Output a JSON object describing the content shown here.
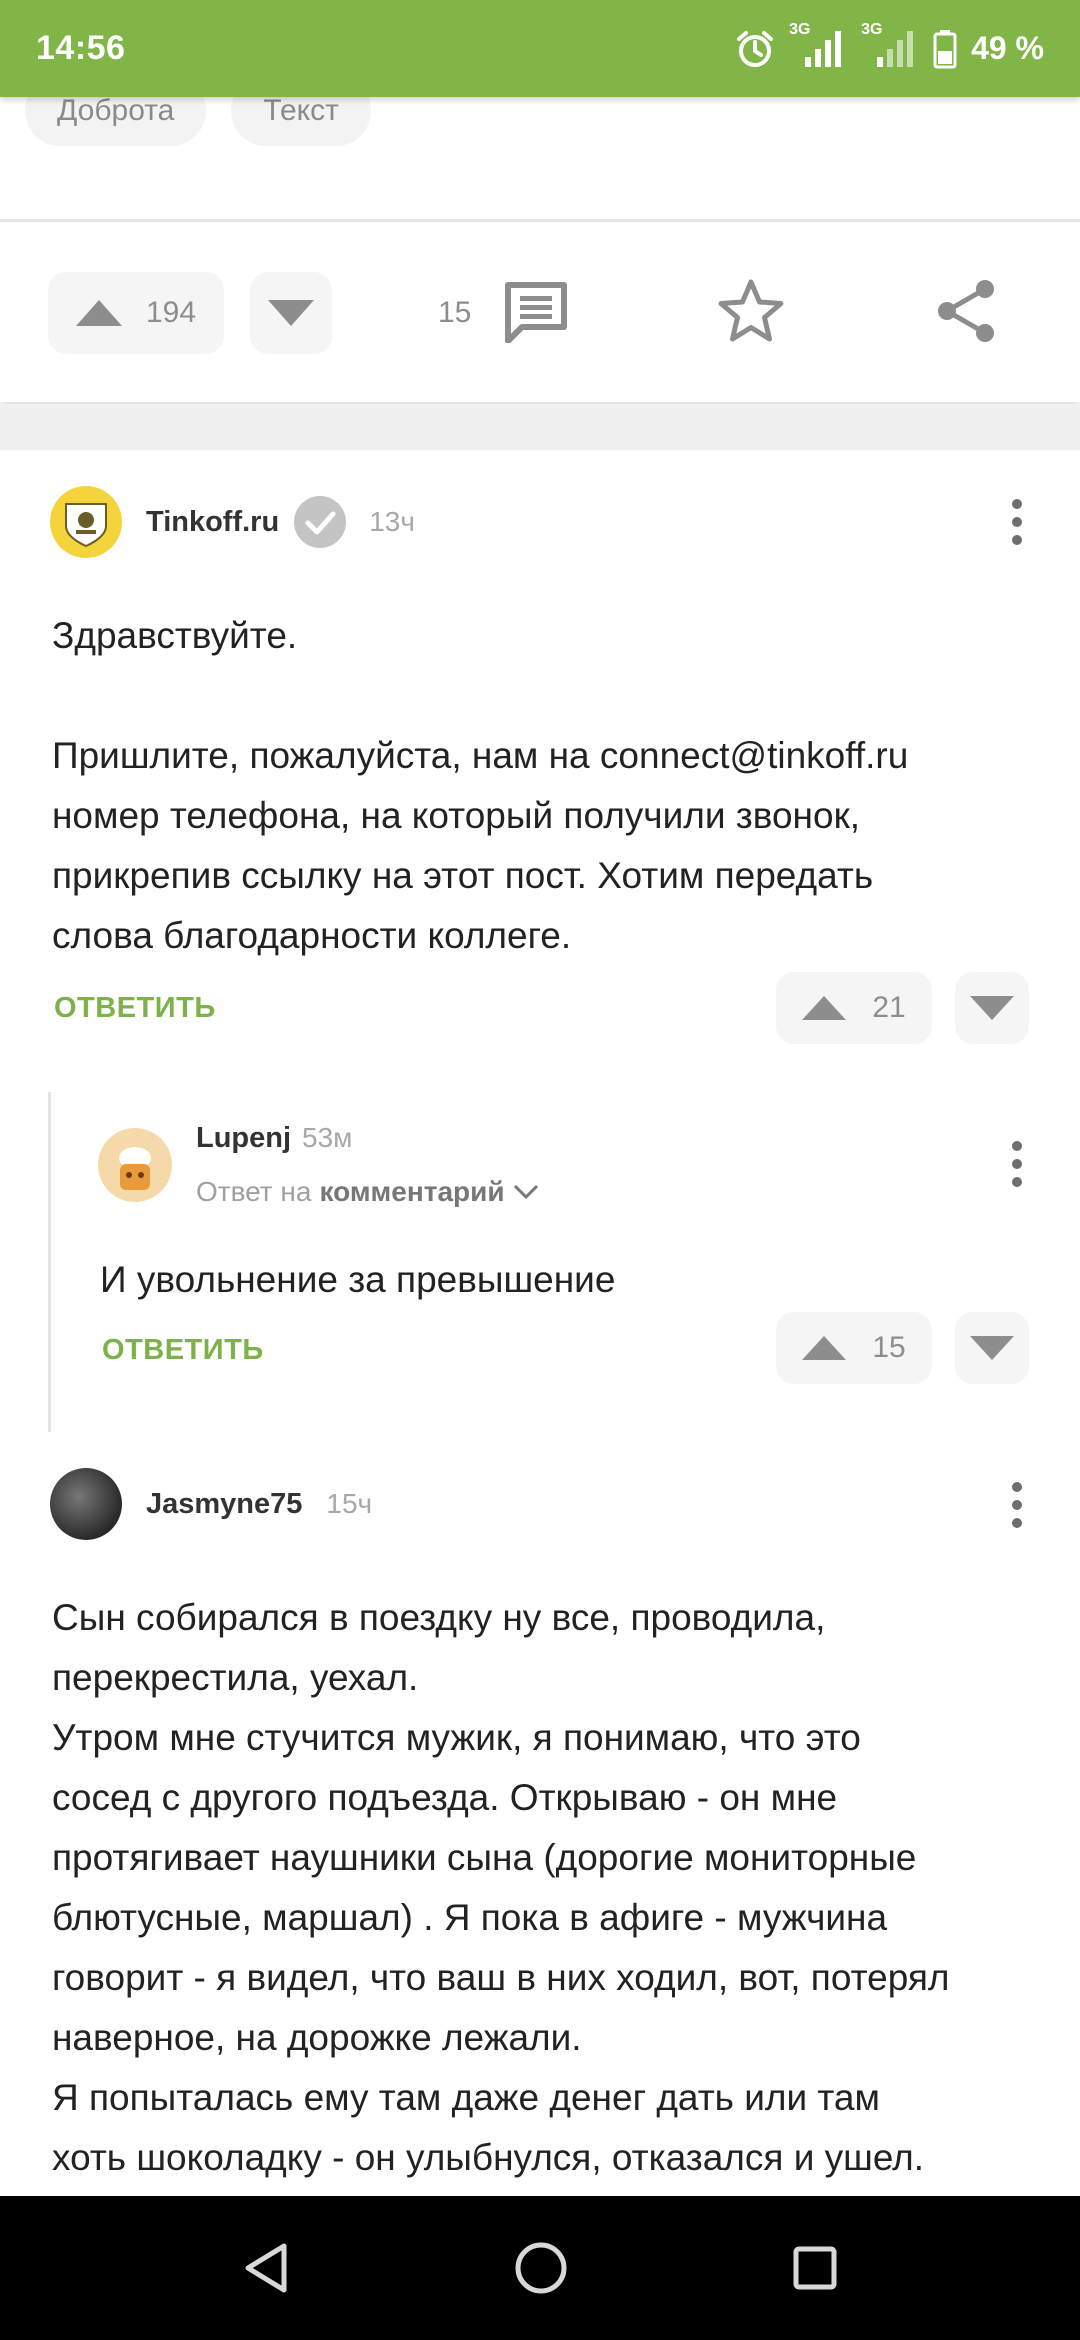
{
  "status_bar": {
    "time": "14:56",
    "network_1": "3G",
    "network_2": "3G",
    "battery": "49 %",
    "icons": [
      "alarm-icon",
      "signal-icon",
      "signal-icon",
      "battery-icon"
    ]
  },
  "tags": [
    "Доброта",
    "Текст"
  ],
  "post_actions": {
    "upvotes": "194",
    "comments": "15",
    "icons": [
      "arrow-up-icon",
      "arrow-down-icon",
      "comment-icon",
      "star-icon",
      "share-icon"
    ]
  },
  "comments": [
    {
      "author": "Tinkoff.ru",
      "verified": true,
      "time": "13ч",
      "text": "Здравствуйте.\n\nПришлите, пожалуйста, нам на connect@tinkoff.ru\nномер телефона, на который получили звонок,\nприкрепив ссылку на этот пост. Хотим передать\nслова благодарности коллеге.",
      "reply_label": "ОТВЕТИТЬ",
      "rating": "21",
      "avatar_color": "#f5d33b"
    },
    {
      "author": "Lupenj",
      "time": "53м",
      "reply_to_prefix": "Ответ на",
      "reply_to_target": "комментарий",
      "text": "И увольнение за превышение",
      "reply_label": "ОТВЕТИТЬ",
      "rating": "15",
      "avatar_color": "#f6d9a8"
    },
    {
      "author": "Jasmyne75",
      "time": "15ч",
      "text": "Сын собирался в поездку ну все, проводила,\nперекрестила, уехал.\nУтром мне стучится мужик, я понимаю, что это\nсосед с другого подъезда. Открываю - он мне\nпротягивает наушники сына (дорогие мониторные\nблютусные, маршал) . Я пока в афиге - мужчина\nговорит - я видел, что ваш в них ходил, вот, потерял\nнаверное, на дорожке лежали.\nЯ попыталась ему там даже денег дать или там\nхоть шоколадку - он улыбнулся, отказался и ушел.",
      "avatar_color": "#3b3b3b"
    }
  ],
  "nav_bar": {
    "icons": [
      "back-icon",
      "home-icon",
      "recents-icon"
    ]
  }
}
